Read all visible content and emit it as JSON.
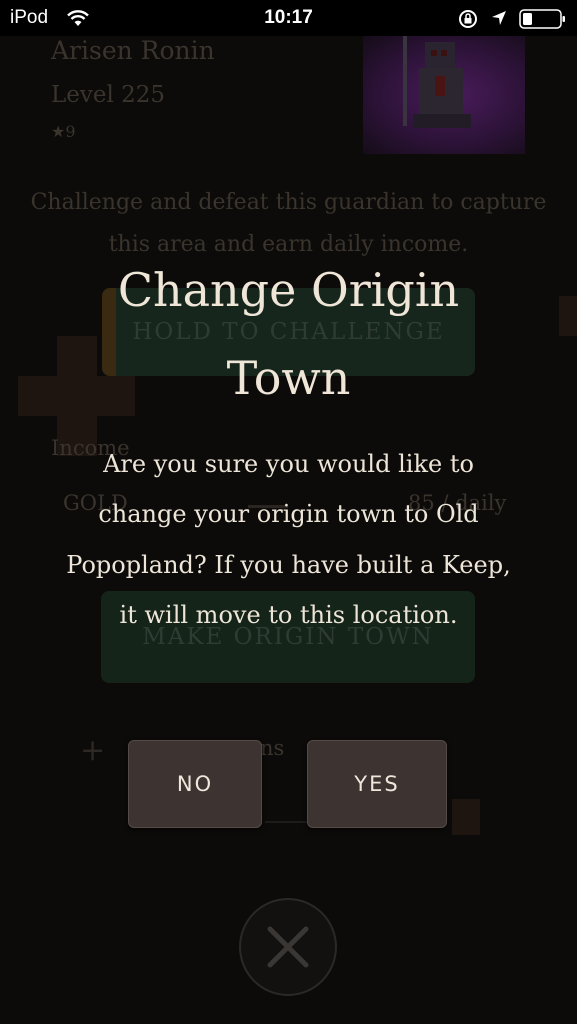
{
  "status_bar": {
    "carrier": "iPod",
    "time": "10:17",
    "icons": [
      "wifi-icon",
      "orientation-lock-icon",
      "location-arrow-icon",
      "battery-icon"
    ]
  },
  "background": {
    "guardian": {
      "name": "Arisen Ronin",
      "level": "Level 225",
      "stars": "★9"
    },
    "description": "Challenge and defeat this guardian to capture this area and earn daily income.",
    "challenge_button": "HOLD TO CHALLENGE",
    "income": {
      "label": "Income",
      "currency": "GOLD",
      "value": "85 / daily"
    },
    "origin_button": "MAKE ORIGIN TOWN",
    "plus": "+",
    "partial_text": "ns"
  },
  "modal": {
    "title": "Change Origin Town",
    "message": "Are you sure you would like to change your origin town to Old Popopland? If you have built a Keep, it will move to this location.",
    "no_label": "NO",
    "yes_label": "YES"
  },
  "colors": {
    "background": "#0c0b0a",
    "modal_text": "#efe6d8",
    "button_bg": "#3d3432"
  }
}
